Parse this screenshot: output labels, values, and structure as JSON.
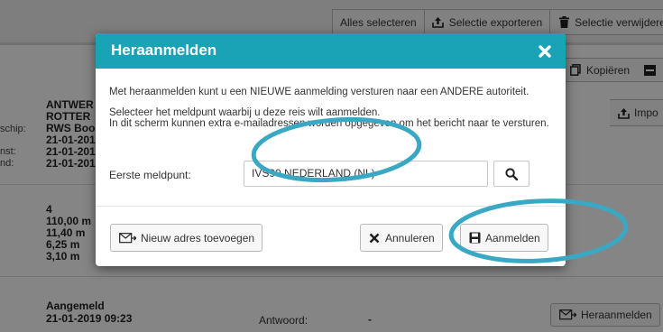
{
  "toolbar": {
    "select_all": "Alles selecteren",
    "export_selection": "Selectie exporteren",
    "delete_selection": "Selectie verwijderen"
  },
  "right_actions": {
    "copy": "Kopiëren",
    "import": "Impo"
  },
  "left_labels": [
    "schip:",
    "nst:",
    "nd:"
  ],
  "voyage": {
    "ports": [
      "ANTWER",
      "ROTTER"
    ],
    "vessel": "RWS Boo",
    "dates": [
      "21-01-201",
      "21-01-201",
      "21-01-201"
    ]
  },
  "dimensions": [
    "4",
    "110,00 m",
    "11,40 m",
    "6,25 m",
    "3,10 m"
  ],
  "status_block": {
    "status": "Aangemeld",
    "datetime": "21-01-2019 09:23",
    "answer_label": "Antwoord:",
    "answer_value": "-",
    "reregister_button": "Heraanmelden"
  },
  "modal": {
    "title": "Heraanmelden",
    "intro": "Met heraanmelden kunt u een NIEUWE aanmelding versturen naar een ANDERE autoriteit.",
    "instruction_1": "Selecteer het meldpunt waarbij u deze reis wilt aanmelden.",
    "instruction_2": "In dit scherm kunnen extra e-mailadressen worden opgegeven om het bericht naar te versturen.",
    "field_label": "Eerste meldpunt:",
    "field_value": "IVS90 NEDERLAND (NL)",
    "buttons": {
      "new_address": "Nieuw adres toevoegen",
      "cancel": "Annuleren",
      "submit": "Aanmelden"
    }
  },
  "colors": {
    "header": "#1aa2b7",
    "annotation": "#3aa8c4"
  },
  "icons": [
    "upload-icon",
    "trash-icon",
    "copy-icon",
    "import-icon",
    "close-icon",
    "search-icon",
    "envelope-icon",
    "x-icon",
    "save-icon"
  ]
}
